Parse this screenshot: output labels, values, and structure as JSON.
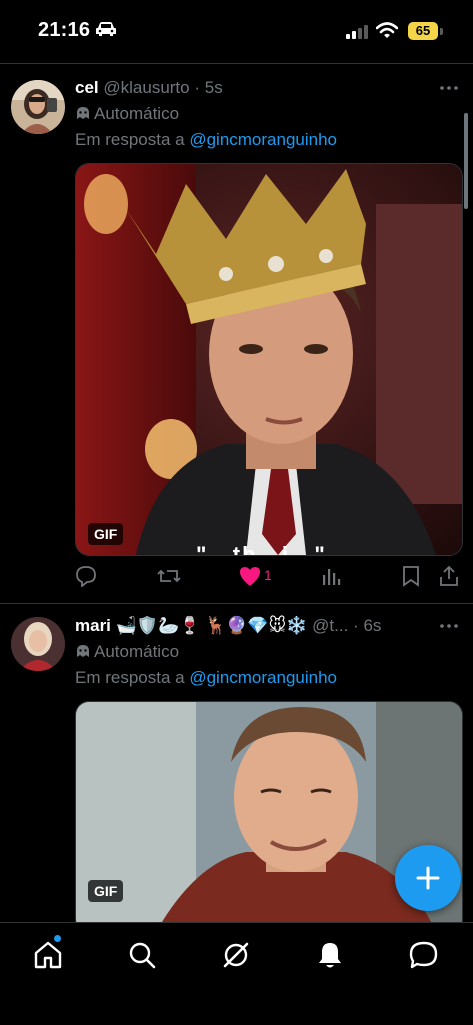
{
  "status_bar": {
    "time": "21:16",
    "battery": "65"
  },
  "tweets": [
    {
      "name": "cel",
      "handle": "@klausurto",
      "separator": "·",
      "age": "5s",
      "automatic_label": "Automático",
      "reply_prefix": "Em resposta a ",
      "reply_to": "@gincmoranguinho",
      "media_badge": "GIF",
      "caption_fragment": "\"...th...i...\"",
      "like_count": "1"
    },
    {
      "name": "mari 🛁🛡️🦢🍷 🦌🔮💎🐭❄️",
      "handle": "@t...",
      "separator": "·",
      "age": "6s",
      "automatic_label": "Automático",
      "reply_prefix": "Em resposta a ",
      "reply_to": "@gincmoranguinho",
      "media_badge": "GIF"
    }
  ],
  "colors": {
    "accent": "#1d9bf0",
    "like": "#f91880",
    "battery": "#f5d547",
    "muted": "#71767b"
  },
  "icons": [
    "car-icon",
    "signal-icon",
    "wifi-icon",
    "more-icon",
    "bot-icon",
    "reply-icon",
    "retweet-icon",
    "heart-icon",
    "views-icon",
    "bookmark-icon",
    "share-icon",
    "compose-icon",
    "home-icon",
    "search-icon",
    "grok-icon",
    "bell-icon",
    "messages-icon"
  ]
}
